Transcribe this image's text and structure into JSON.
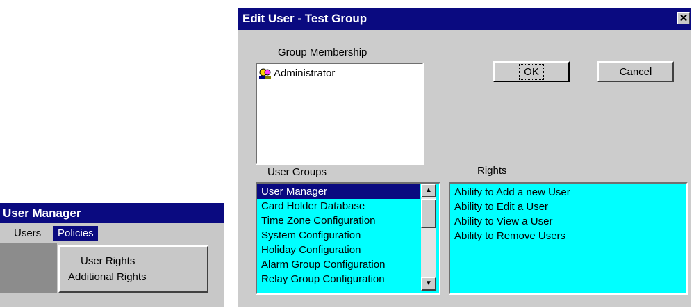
{
  "user_manager": {
    "title": "User Manager",
    "menu": [
      "Users",
      "Policies"
    ],
    "dropdown": [
      "User Rights",
      "Additional Rights"
    ]
  },
  "dialog": {
    "title": "Edit User - Test Group",
    "close_glyph": "✕",
    "group_membership_label": "Group Membership",
    "group_membership_items": [
      "Administrator"
    ],
    "ok_label": "OK",
    "cancel_label": "Cancel",
    "user_groups_label": "User Groups",
    "rights_label": "Rights",
    "user_groups": [
      "User Manager",
      "Card Holder Database",
      "Time Zone Configuration",
      "System Configuration",
      "Holiday Configuration",
      "Alarm Group Configuration",
      "Relay Group Configuration"
    ],
    "selected_group": "User Manager",
    "rights": [
      "Ability to Add a new User",
      "Ability to Edit a User",
      "Ability to View a User",
      "Ability to Remove Users"
    ]
  },
  "colors": {
    "title_bar": "#0a0a80",
    "list_background": "#00ffff",
    "window_face": "#cccccc"
  },
  "icons": [
    "administrator-group-icon",
    "close-icon",
    "scroll-up-arrow-icon",
    "scroll-down-arrow-icon"
  ]
}
